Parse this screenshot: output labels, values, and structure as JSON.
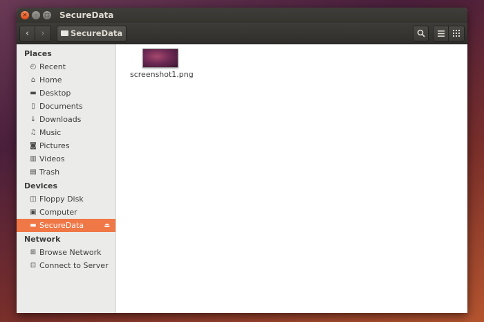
{
  "window": {
    "title": "SecureData"
  },
  "toolbar": {
    "back_icon": "chevron-left-icon",
    "forward_icon": "chevron-right-icon",
    "path_label": "SecureData",
    "search_icon": "search-icon",
    "list_icon": "list-view-icon",
    "grid_icon": "grid-view-icon"
  },
  "sidebar": {
    "places_header": "Places",
    "places": [
      {
        "label": "Recent",
        "icon": "clock-icon"
      },
      {
        "label": "Home",
        "icon": "home-icon"
      },
      {
        "label": "Desktop",
        "icon": "folder-icon"
      },
      {
        "label": "Documents",
        "icon": "document-icon"
      },
      {
        "label": "Downloads",
        "icon": "download-icon"
      },
      {
        "label": "Music",
        "icon": "music-icon"
      },
      {
        "label": "Pictures",
        "icon": "camera-icon"
      },
      {
        "label": "Videos",
        "icon": "film-icon"
      },
      {
        "label": "Trash",
        "icon": "trash-icon"
      }
    ],
    "devices_header": "Devices",
    "devices": [
      {
        "label": "Floppy Disk",
        "icon": "floppy-icon"
      },
      {
        "label": "Computer",
        "icon": "computer-icon"
      },
      {
        "label": "SecureData",
        "icon": "drive-icon",
        "active": true
      }
    ],
    "network_header": "Network",
    "network": [
      {
        "label": "Browse Network",
        "icon": "network-icon"
      },
      {
        "label": "Connect to Server",
        "icon": "server-icon"
      }
    ],
    "accent_color": "#f07746"
  },
  "files": [
    {
      "name": "screenshot1.png"
    }
  ]
}
